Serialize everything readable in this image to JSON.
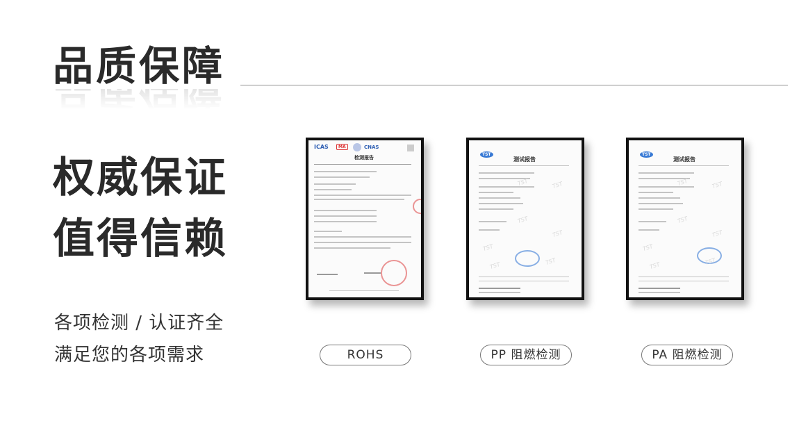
{
  "header": {
    "title": "品质保障"
  },
  "headline": {
    "line1": "权威保证",
    "line2": "值得信赖"
  },
  "subtitle": {
    "line1": "各项检测 / 认证齐全",
    "line2": "满足您的各项需求"
  },
  "certificates": [
    {
      "label": "ROHS",
      "doc_heading": "检测报告",
      "logos": [
        "ICAS",
        "MA",
        "CNAS"
      ]
    },
    {
      "label": "PP 阻燃检测",
      "doc_heading": "测试报告",
      "logo": "TST"
    },
    {
      "label": "PA 阻燃检测",
      "doc_heading": "测试报告",
      "logo": "TST"
    }
  ],
  "colors": {
    "text": "#2a2a2a",
    "frame": "#111111",
    "rule": "#8e8e8e",
    "seal_red": "#e05050",
    "seal_blue": "#3a7bd5"
  }
}
